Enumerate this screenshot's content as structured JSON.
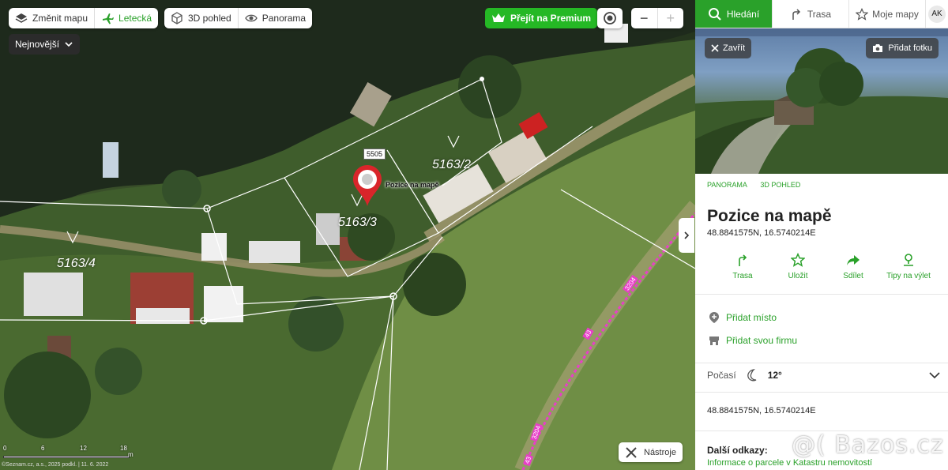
{
  "map_toolbar": {
    "change_map": "Změnit mapu",
    "aerial": "Letecká",
    "view_3d": "3D pohled",
    "panorama": "Panorama"
  },
  "sort_label": "Nejnovější",
  "premium_label": "Přejít na Premium",
  "map": {
    "parcels": [
      "5163/2",
      "5163/3",
      "5163/4"
    ],
    "parcel_tag": "5505",
    "pin_label": "Pozice na mapě",
    "tools_label": "Nástroje",
    "scale_ticks": [
      "0",
      "6",
      "12",
      "18"
    ],
    "scale_unit": "m",
    "copyright": "©Seznam.cz, a.s., 2025 podkl. | 11. 6. 2022",
    "road_numbers": [
      "3204",
      "43",
      "3204",
      "43"
    ]
  },
  "panel": {
    "tabs": [
      "Hledání",
      "Trasa",
      "Moje mapy"
    ],
    "user_initials": "AK",
    "close_label": "Zavřít",
    "add_photo_label": "Přidat fotku",
    "links": [
      "PANORAMA",
      "3D POHLED"
    ],
    "title": "Pozice na mapě",
    "coordinates": "48.8841575N, 16.5740214E",
    "actions": [
      "Trasa",
      "Uložit",
      "Sdílet",
      "Tipy na výlet"
    ],
    "add_place": "Přidat místo",
    "add_company": "Přidat svou firmu",
    "weather_label": "Počasí",
    "weather_temp": "12°",
    "coordinates_2": "48.8841575N, 16.5740214E",
    "more_links_title": "Další odkazy:",
    "more_link": "Informace o parcele v Katastru nemovitostí"
  },
  "watermark": "@( Bazos.cz",
  "colors": {
    "accent": "#2aa12a",
    "premium": "#25b825",
    "route_line": "#e83ec8"
  }
}
